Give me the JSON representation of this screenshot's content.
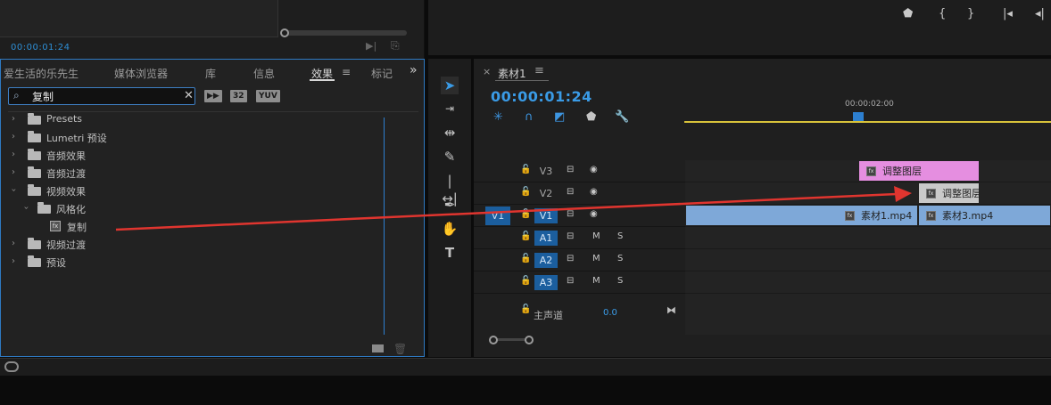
{
  "source_monitor": {
    "timecode": "00:00:01:24"
  },
  "effects_panel": {
    "tabs": [
      "爱生活的乐先生",
      "媒体浏览器",
      "库",
      "信息",
      "效果",
      "标记"
    ],
    "active_tab": "效果",
    "menu_glyph": "≡",
    "overflow_glyph": "»",
    "search": {
      "value": "复制",
      "clear_glyph": "✕",
      "search_glyph": "⌕"
    },
    "filter_badges": [
      "32",
      "YUV"
    ],
    "tree": [
      {
        "label": "Presets",
        "level": 0,
        "expanded": false,
        "icon": "folder-star-icon"
      },
      {
        "label": "Lumetri 预设",
        "level": 0,
        "expanded": false,
        "icon": "folder-star-icon"
      },
      {
        "label": "音频效果",
        "level": 0,
        "expanded": false,
        "icon": "folder-icon"
      },
      {
        "label": "音频过渡",
        "level": 0,
        "expanded": false,
        "icon": "folder-icon"
      },
      {
        "label": "视频效果",
        "level": 0,
        "expanded": true,
        "icon": "folder-icon"
      },
      {
        "label": "风格化",
        "level": 1,
        "expanded": true,
        "icon": "folder-icon"
      },
      {
        "label": "复制",
        "level": 2,
        "expanded": false,
        "icon": "fx-icon"
      },
      {
        "label": "视频过渡",
        "level": 0,
        "expanded": false,
        "icon": "folder-icon"
      },
      {
        "label": "预设",
        "level": 0,
        "expanded": false,
        "icon": "folder-star-icon"
      }
    ]
  },
  "tools": [
    "selection-tool",
    "track-select-tool",
    "ripple-edit-tool",
    "razor-tool",
    "slip-tool",
    "pen-tool",
    "hand-tool",
    "type-tool"
  ],
  "timeline": {
    "sequence_name": "素材1",
    "close_glyph": "×",
    "menu_glyph": "≡",
    "timecode": "00:00:01:24",
    "ruler_label": "00:00:02:00",
    "tracks": [
      {
        "name": "V3",
        "type": "video",
        "targeted": false
      },
      {
        "name": "V2",
        "type": "video",
        "targeted": false
      },
      {
        "name": "V1",
        "type": "video",
        "targeted": true,
        "source_patch": "V1"
      },
      {
        "name": "A1",
        "type": "audio",
        "targeted": true
      },
      {
        "name": "A2",
        "type": "audio",
        "targeted": true
      },
      {
        "name": "A3",
        "type": "audio",
        "targeted": true
      }
    ],
    "master": {
      "label": "主声道",
      "value": "0.0"
    },
    "mute_label": "M",
    "solo_label": "S",
    "clips": [
      {
        "label": "调整图层",
        "track": "V3",
        "color": "#e58ee0"
      },
      {
        "label": "调整图层",
        "track": "V2",
        "color": "#c9c9c9"
      },
      {
        "label": "素材1.mp4",
        "track": "V1",
        "color": "#7ea8d8"
      },
      {
        "label": "素材3.mp4",
        "track": "V1",
        "color": "#7ea8d8"
      }
    ]
  },
  "colors": {
    "accent": "#2e8fd6",
    "annotation_arrow": "#e0352f"
  }
}
